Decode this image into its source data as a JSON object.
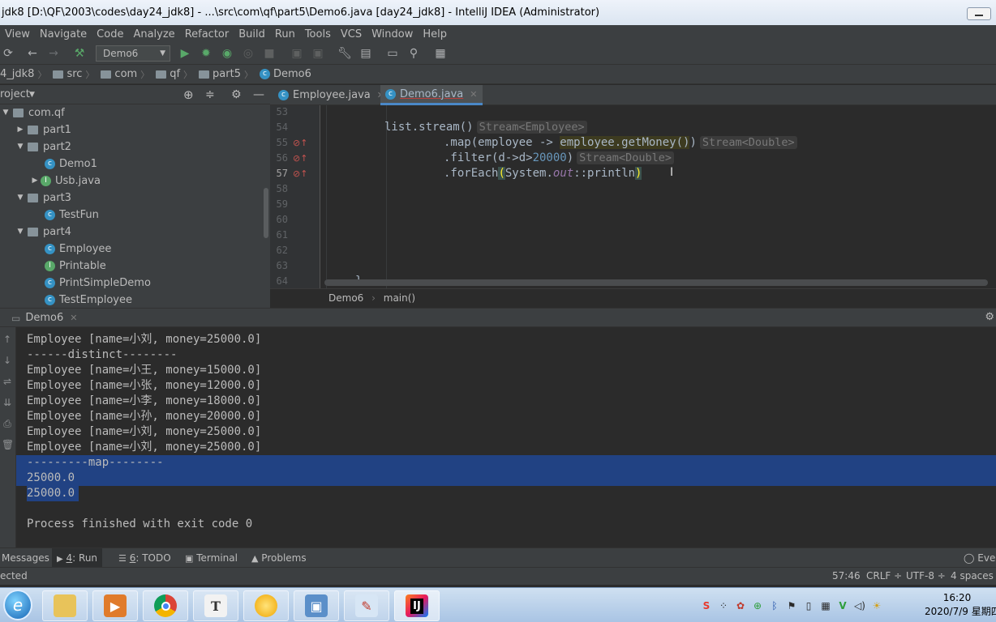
{
  "window": {
    "title": "jdk8 [D:\\QF\\2003\\codes\\day24_jdk8] - ...\\src\\com\\qf\\part5\\Demo6.java [day24_jdk8] - IntelliJ IDEA (Administrator)"
  },
  "menu": [
    "View",
    "Navigate",
    "Code",
    "Analyze",
    "Refactor",
    "Build",
    "Run",
    "Tools",
    "VCS",
    "Window",
    "Help"
  ],
  "toolbar": {
    "run_config": "Demo6"
  },
  "breadcrumb": [
    "4_jdk8",
    "src",
    "com",
    "qf",
    "part5",
    "Demo6"
  ],
  "project": {
    "header": "roject",
    "tree": [
      {
        "label": "com.qf",
        "kind": "package",
        "depth": 0,
        "expanded": true
      },
      {
        "label": "part1",
        "kind": "package",
        "depth": 1,
        "expanded": false
      },
      {
        "label": "part2",
        "kind": "package",
        "depth": 1,
        "expanded": true
      },
      {
        "label": "Demo1",
        "kind": "class",
        "depth": 2
      },
      {
        "label": "Usb.java",
        "kind": "interface",
        "depth": 2,
        "collapsed": true
      },
      {
        "label": "part3",
        "kind": "package",
        "depth": 1,
        "expanded": true
      },
      {
        "label": "TestFun",
        "kind": "class",
        "depth": 2
      },
      {
        "label": "part4",
        "kind": "package",
        "depth": 1,
        "expanded": true
      },
      {
        "label": "Employee",
        "kind": "class",
        "depth": 2
      },
      {
        "label": "Printable",
        "kind": "interface",
        "depth": 2
      },
      {
        "label": "PrintSimpleDemo",
        "kind": "class",
        "depth": 2
      },
      {
        "label": "TestEmployee",
        "kind": "class",
        "depth": 2
      }
    ]
  },
  "editor": {
    "tabs": [
      {
        "label": "Employee.java",
        "active": false
      },
      {
        "label": "Demo6.java",
        "active": true
      }
    ],
    "line_numbers": [
      "53",
      "54",
      "55",
      "56",
      "57",
      "58",
      "59",
      "60",
      "61",
      "62",
      "63",
      "64"
    ],
    "code": {
      "l54": "list.stream()",
      "l54_hint": "Stream<Employee>",
      "l55_pre": ".map(employee -> ",
      "l55_hl": "employee.getMoney()",
      "l55_post": ")",
      "l55_hint": "Stream<Double>",
      "l56_pre": ".filter(d->d>",
      "l56_num": "20000",
      "l56_post": ")",
      "l56_hint": "Stream<Double>",
      "l57_a": ".forEach",
      "l57_b": "(",
      "l57_c": "System.",
      "l57_d": "out",
      "l57_e": "::println",
      "l57_f": ")",
      "l64": "}"
    },
    "crumb": [
      "Demo6",
      "main()"
    ]
  },
  "run": {
    "tab": "Demo6",
    "lines": [
      "Employee [name=小刘, money=25000.0]",
      "------distinct--------",
      "Employee [name=小王, money=15000.0]",
      "Employee [name=小张, money=12000.0]",
      "Employee [name=小李, money=18000.0]",
      "Employee [name=小孙, money=20000.0]",
      "Employee [name=小刘, money=25000.0]",
      "Employee [name=小刘, money=25000.0]",
      "---------map--------",
      "25000.0",
      "25000.0",
      "",
      "Process finished with exit code 0"
    ]
  },
  "tool_tabs": {
    "messages": "Messages",
    "run_num": "4",
    "run_label": ": Run",
    "todo_num": "6",
    "todo_label": ": TODO",
    "terminal": "Terminal",
    "problems": "Problems",
    "event": "Ever"
  },
  "status": {
    "left": "ected",
    "position": "57:46",
    "line_sep": "CRLF ÷",
    "encoding": "UTF-8 ÷",
    "indent": "4 spaces"
  },
  "taskbar": {
    "time": "16:20",
    "date": "2020/7/9 星期四"
  },
  "colors": {
    "editor_bg": "#2b2b2b",
    "panel_bg": "#3c3f41",
    "selection": "#214283",
    "accent": "#4a88c7"
  }
}
